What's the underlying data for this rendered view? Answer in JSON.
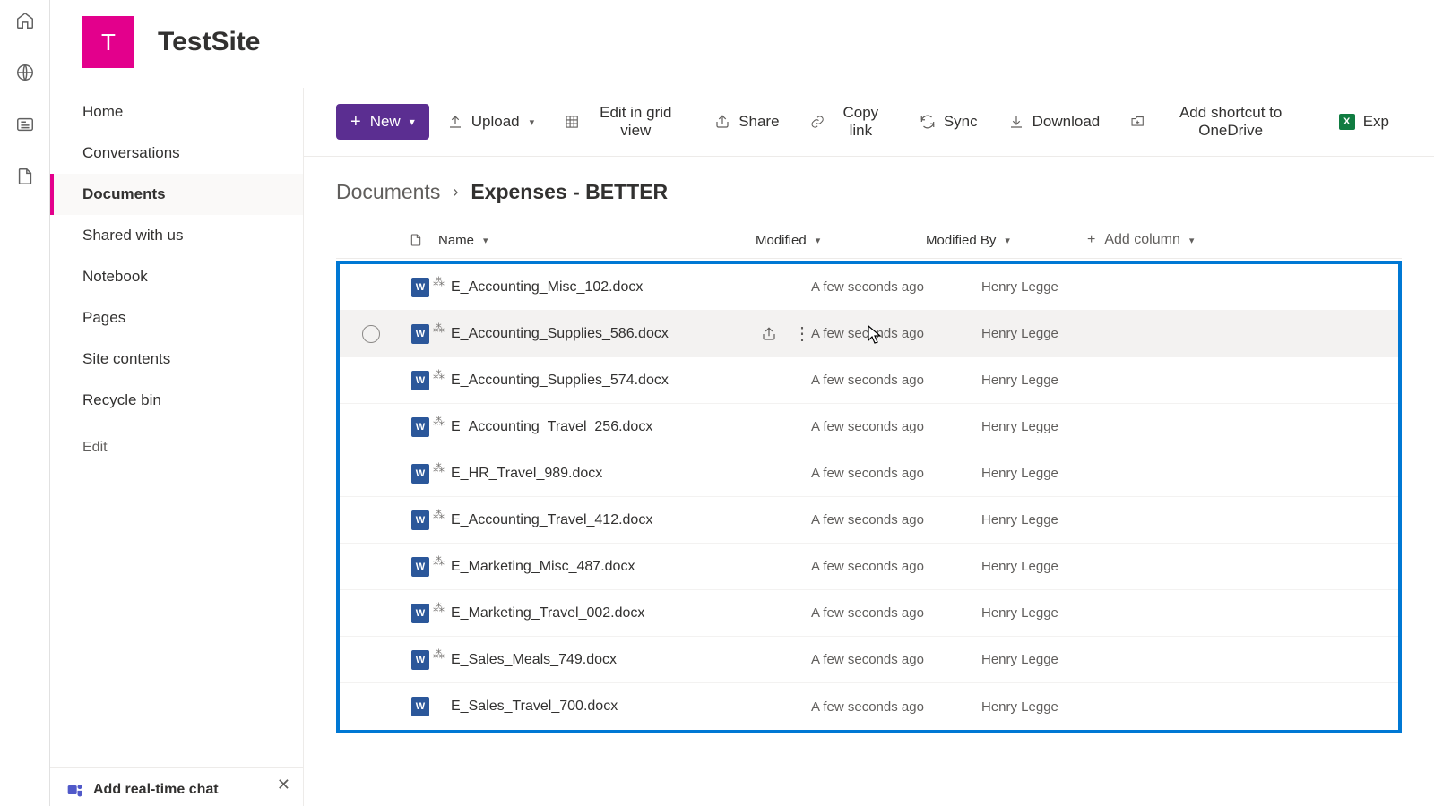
{
  "site": {
    "logo_letter": "T",
    "title": "TestSite"
  },
  "railIcons": [
    "home",
    "globe",
    "news",
    "file"
  ],
  "sidenav": {
    "items": [
      {
        "label": "Home",
        "active": false
      },
      {
        "label": "Conversations",
        "active": false
      },
      {
        "label": "Documents",
        "active": true
      },
      {
        "label": "Shared with us",
        "active": false
      },
      {
        "label": "Notebook",
        "active": false
      },
      {
        "label": "Pages",
        "active": false
      },
      {
        "label": "Site contents",
        "active": false
      },
      {
        "label": "Recycle bin",
        "active": false
      }
    ],
    "edit_label": "Edit",
    "chat_promo": "Add real-time chat"
  },
  "toolbar": {
    "new_label": "New",
    "upload_label": "Upload",
    "grid_label": "Edit in grid view",
    "share_label": "Share",
    "copy_label": "Copy link",
    "sync_label": "Sync",
    "download_label": "Download",
    "onedrive_label": "Add shortcut to OneDrive",
    "export_label": "Exp"
  },
  "breadcrumb": {
    "root": "Documents",
    "current": "Expenses - BETTER"
  },
  "columns": {
    "name": "Name",
    "modified": "Modified",
    "modified_by": "Modified By",
    "add": "Add column"
  },
  "files": [
    {
      "name": "E_Accounting_Misc_102.docx",
      "modified": "A few seconds ago",
      "by": "Henry Legge",
      "new": true,
      "hovered": false
    },
    {
      "name": "E_Accounting_Supplies_586.docx",
      "modified": "A few seconds ago",
      "by": "Henry Legge",
      "new": true,
      "hovered": true
    },
    {
      "name": "E_Accounting_Supplies_574.docx",
      "modified": "A few seconds ago",
      "by": "Henry Legge",
      "new": true,
      "hovered": false
    },
    {
      "name": "E_Accounting_Travel_256.docx",
      "modified": "A few seconds ago",
      "by": "Henry Legge",
      "new": true,
      "hovered": false
    },
    {
      "name": "E_HR_Travel_989.docx",
      "modified": "A few seconds ago",
      "by": "Henry Legge",
      "new": true,
      "hovered": false
    },
    {
      "name": "E_Accounting_Travel_412.docx",
      "modified": "A few seconds ago",
      "by": "Henry Legge",
      "new": true,
      "hovered": false
    },
    {
      "name": "E_Marketing_Misc_487.docx",
      "modified": "A few seconds ago",
      "by": "Henry Legge",
      "new": true,
      "hovered": false
    },
    {
      "name": "E_Marketing_Travel_002.docx",
      "modified": "A few seconds ago",
      "by": "Henry Legge",
      "new": true,
      "hovered": false
    },
    {
      "name": "E_Sales_Meals_749.docx",
      "modified": "A few seconds ago",
      "by": "Henry Legge",
      "new": true,
      "hovered": false
    },
    {
      "name": "E_Sales_Travel_700.docx",
      "modified": "A few seconds ago",
      "by": "Henry Legge",
      "new": false,
      "hovered": false
    }
  ]
}
